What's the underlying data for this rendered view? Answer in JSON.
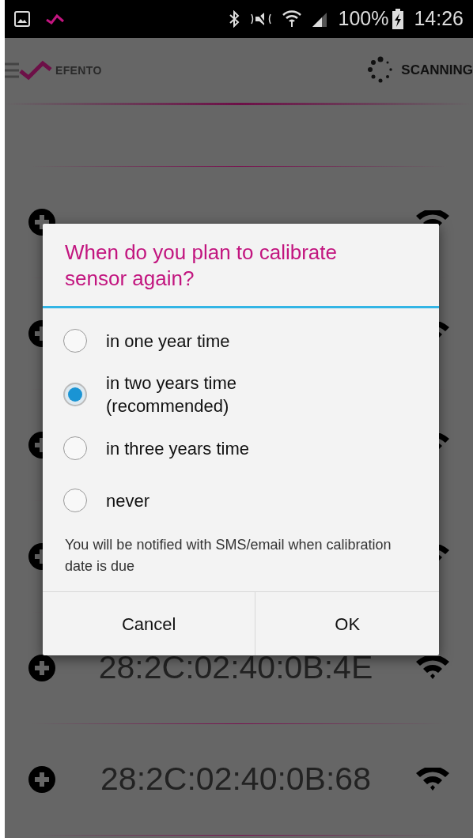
{
  "status_bar": {
    "battery": "100%",
    "time": "14:26"
  },
  "app_bar": {
    "brand": "EFENTO",
    "status": "SCANNING"
  },
  "devices": [
    {
      "kind": "covered"
    },
    {
      "kind": "covered"
    },
    {
      "kind": "covered"
    },
    {
      "kind": "covered"
    },
    {
      "kind": "listed",
      "address": "28:2C:02:40:0B:4E"
    },
    {
      "kind": "listed",
      "address": "28:2C:02:40:0B:68"
    }
  ],
  "dialog": {
    "title": "When do you plan to calibrate sensor again?",
    "options": [
      {
        "label": "in one year time",
        "selected": false
      },
      {
        "label": "in two years time (recommended)",
        "selected": true
      },
      {
        "label": "in three years time",
        "selected": false
      },
      {
        "label": "never",
        "selected": false
      }
    ],
    "note": "You will be notified with SMS/email when calibration date is due",
    "buttons": [
      "Cancel",
      "OK"
    ]
  }
}
